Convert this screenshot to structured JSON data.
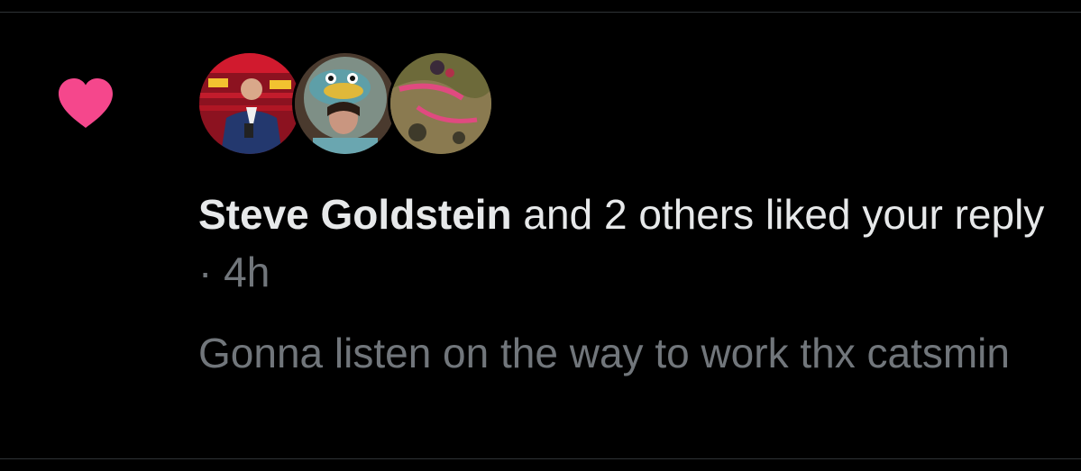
{
  "notification": {
    "type_icon": "heart-icon",
    "accent_color": "#f91880",
    "avatars": [
      {
        "icon": "avatar-sports-broadcaster"
      },
      {
        "icon": "avatar-person-in-costume"
      },
      {
        "icon": "avatar-abstract-photo"
      }
    ],
    "actor_name": "Steve Goldstein",
    "action_text": " and 2 others liked your reply",
    "separator": " · ",
    "time_ago": "4h",
    "reply_text": "Gonna listen on the way to work thx catsmin"
  }
}
